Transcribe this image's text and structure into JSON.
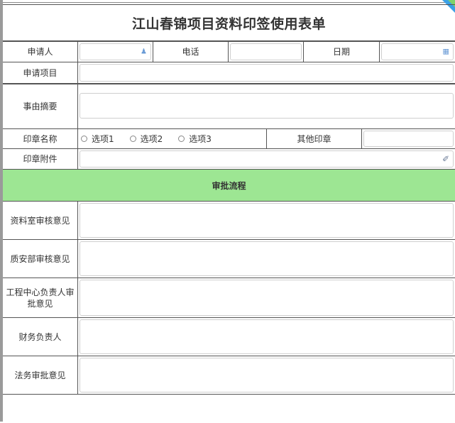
{
  "form": {
    "title": "江山春锦项目资料印签使用表单",
    "row1": {
      "applicant_label": "申请人",
      "phone_label": "电话",
      "date_label": "日期"
    },
    "project_label": "申请项目",
    "summary_label": "事由摘要",
    "seal": {
      "label": "印章名称",
      "options": [
        "选项1",
        "选项2",
        "选项3"
      ],
      "other_label": "其他印章"
    },
    "attachment_label": "印章附件",
    "approval": {
      "section_title": "审批流程",
      "items": [
        "资料室审核意见",
        "质安部审核意见",
        "工程中心负责人审批意见",
        "财务负责人",
        "法务审批意见"
      ]
    }
  },
  "icons": {
    "user": "person-icon",
    "calendar": "calendar-icon",
    "attachment": "paperclip-icon"
  },
  "colors": {
    "section_bg": "#9de693",
    "corner_blue": "#3aa0e6",
    "corner_green": "#7ed36a"
  }
}
